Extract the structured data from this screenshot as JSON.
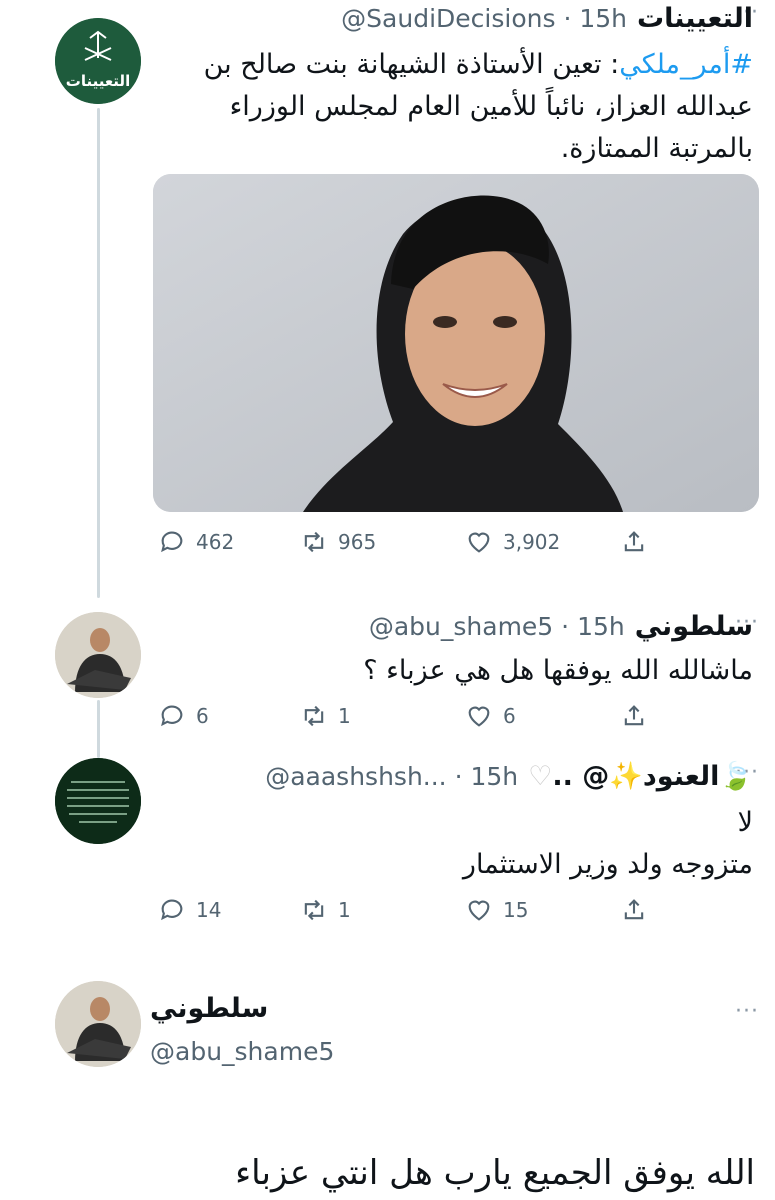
{
  "tweets": [
    {
      "name": "التعيينات",
      "handle": "@SaudiDecisions",
      "time": "· 15h",
      "more": "···",
      "avatar_text": "التعيينات",
      "hashtag": "#أمر_ملكي",
      "text": ": تعين الأستاذة الشيهانة بنت صالح بن عبدالله العزاز، نائباً للأمين العام لمجلس الوزراء بالمرتبة الممتازة.",
      "replies": "462",
      "retweets": "965",
      "likes": "3,902"
    },
    {
      "name": "سلطوني",
      "handle": "@abu_shame5",
      "time": "· 15h",
      "more": "···",
      "text": "ماشالله الله يوفقها هل هي عزباء ؟",
      "replies": "6",
      "retweets": "1",
      "likes": "6"
    },
    {
      "name": "العنود",
      "name_suffix": "@ ..",
      "handle": "@aaashshsh...",
      "time": "· 15h",
      "more": "···",
      "line1": "لا",
      "line2": "متزوجه ولد وزير الاستثمار",
      "replies": "14",
      "retweets": "1",
      "likes": "15"
    }
  ],
  "final": {
    "name": "سلطوني",
    "handle": "@abu_shame5",
    "more": "···",
    "text": "الله يوفق الجميع يارب هل انتي عزباء"
  },
  "colors": {
    "accent": "#1d9bf0",
    "muted": "#536471",
    "thread_line": "#cfd9de",
    "avatar_green": "#1e5b3c"
  }
}
